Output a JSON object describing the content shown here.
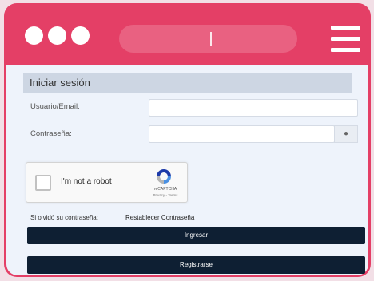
{
  "app": {
    "section_title": "Iniciar sesión"
  },
  "form": {
    "user_label": "Usuario/Email:",
    "user_value": "",
    "password_label": "Contraseña:",
    "password_value": "",
    "eye_icon": "eye-icon"
  },
  "captcha": {
    "label": "I'm not a robot",
    "brand": "reCAPTCHA",
    "links": "Privacy - Terms"
  },
  "links": {
    "forgot_text": "Si olvidó su contraseña:",
    "reset_label": "Restablecer Contraseña"
  },
  "buttons": {
    "login": "Ingresar",
    "register": "Registrarse"
  },
  "colors": {
    "frame": "#e43f66",
    "button": "#0e1f33",
    "header": "#cdd6e3",
    "background": "#eef3fb"
  }
}
